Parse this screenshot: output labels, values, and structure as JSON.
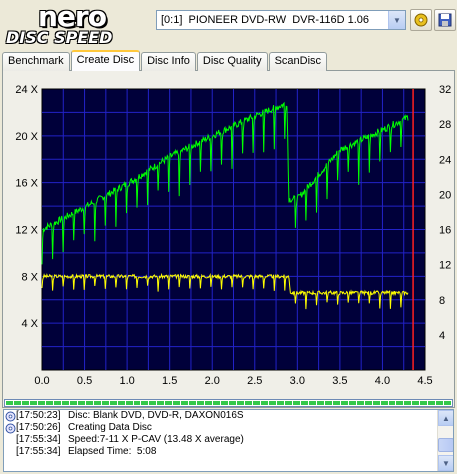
{
  "app": {
    "logo_top": "nero",
    "logo_bottom": "DISC SPEED"
  },
  "drive": {
    "selected": "[0:1]  PIONEER DVD-RW  DVR-116D 1.06"
  },
  "tabs": [
    {
      "label": "Benchmark",
      "active": false
    },
    {
      "label": "Create Disc",
      "active": true
    },
    {
      "label": "Disc Info",
      "active": false
    },
    {
      "label": "Disc Quality",
      "active": false
    },
    {
      "label": "ScanDisc",
      "active": false
    }
  ],
  "chart_data": {
    "type": "line",
    "x_ticks": [
      "0.0",
      "0.5",
      "1.0",
      "1.5",
      "2.0",
      "2.5",
      "3.0",
      "3.5",
      "4.0",
      "4.5"
    ],
    "y_left_ticks": [
      "4 X",
      "8 X",
      "12 X",
      "16 X",
      "20 X",
      "24 X"
    ],
    "y_right_ticks": [
      "4",
      "8",
      "12",
      "16",
      "20",
      "24",
      "28",
      "32"
    ],
    "xlim": [
      0,
      4.5
    ],
    "ylim_left": [
      0,
      24
    ],
    "ylim_right": [
      0,
      32
    ],
    "marker_x": 4.36,
    "series": [
      {
        "color": "#00ff00",
        "x": [
          0,
          0.5,
          1.0,
          1.5,
          2.0,
          2.5,
          2.88,
          2.9,
          3.0,
          3.5,
          4.0,
          4.3
        ],
        "y": [
          12,
          13.9,
          15.9,
          18.2,
          20,
          21.7,
          22.8,
          14.6,
          14.6,
          18.8,
          20.5,
          21.6
        ]
      },
      {
        "color": "#ffff00",
        "x": [
          0,
          2.9,
          2.92,
          4.3
        ],
        "y": [
          8,
          8,
          6.6,
          6.6
        ]
      }
    ]
  },
  "colors": {
    "plot_bg": "#00003a",
    "grid": "#2222c8",
    "write_speed": "#00ff00",
    "spin_speed": "#ffff00",
    "end_marker": "#ff2020"
  },
  "log": [
    {
      "icon": "disc-icon",
      "time": "[17:50:23]",
      "msg": "Disc: Blank DVD, DVD-R, DAXON016S"
    },
    {
      "icon": "disc-icon",
      "time": "[17:50:26]",
      "msg": "Creating Data Disc"
    },
    {
      "icon": "",
      "time": "[17:55:34]",
      "msg": "Speed:7-11 X P-CAV (13.48 X average)"
    },
    {
      "icon": "",
      "time": "[17:55:34]",
      "msg": "Elapsed Time:  5:08"
    }
  ]
}
